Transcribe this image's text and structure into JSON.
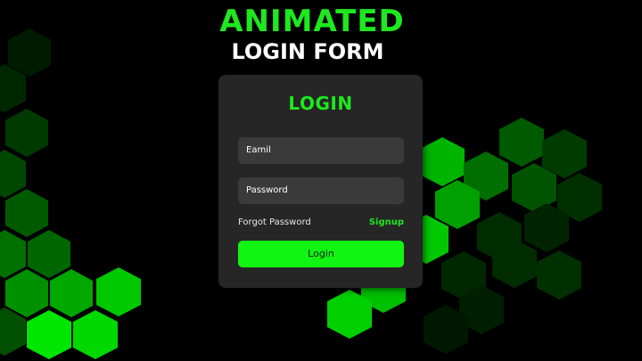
{
  "hero": {
    "title": "ANIMATED",
    "subtitle": "LOGIN FORM"
  },
  "login_card": {
    "title": "LOGIN",
    "email_label": "Eamil",
    "password_label": "Password",
    "forgot_label": "Forgot Password",
    "signup_label": "Signup",
    "login_button_label": "Login"
  },
  "colors": {
    "background": "#000000",
    "accent": "#1ee81e",
    "card": "#262626",
    "field": "#3a3a3a",
    "button": "#12f512"
  }
}
